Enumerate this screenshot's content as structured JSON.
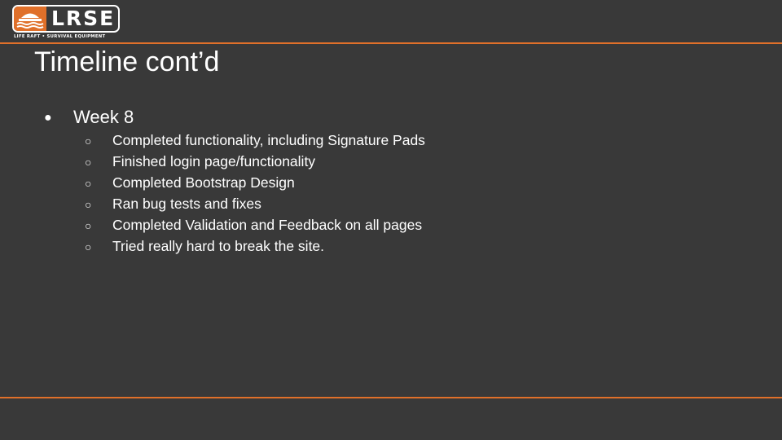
{
  "brand": {
    "logo_text": "LRSE",
    "tagline": "LIFE RAFT • SURVIVAL EQUIPMENT",
    "accent_color": "#e0702a",
    "background_color": "#393939",
    "logo_icon": "life-raft-icon"
  },
  "slide": {
    "title": "Timeline cont’d",
    "bullets": [
      {
        "marker": "●",
        "label": "Week 8",
        "subitems": [
          {
            "marker": "○",
            "label": "Completed functionality, including Signature Pads"
          },
          {
            "marker": "○",
            "label": "Finished login page/functionality"
          },
          {
            "marker": "○",
            "label": "Completed Bootstrap Design"
          },
          {
            "marker": "○",
            "label": "Ran bug tests and fixes"
          },
          {
            "marker": "○",
            "label": "Completed Validation and Feedback on all pages"
          },
          {
            "marker": "○",
            "label": "Tried really hard to break the site."
          }
        ]
      }
    ]
  }
}
